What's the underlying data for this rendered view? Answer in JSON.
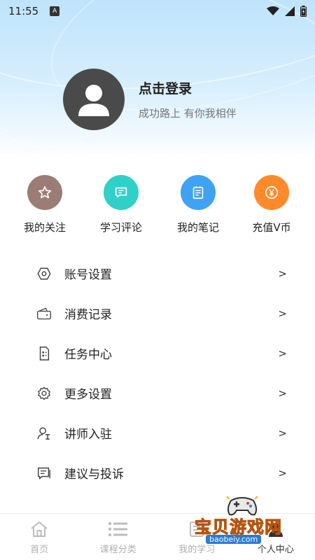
{
  "status_bar": {
    "time": "11:55",
    "notif_letter": "A"
  },
  "profile": {
    "title": "点击登录",
    "subtitle": "成功路上 有你我相伴"
  },
  "quick_actions": [
    {
      "label": "我的关注",
      "color": "#9b7d75",
      "icon": "star-icon"
    },
    {
      "label": "学习评论",
      "color": "#2fd0c8",
      "icon": "comment-icon"
    },
    {
      "label": "我的笔记",
      "color": "#3fa2f3",
      "icon": "note-icon"
    },
    {
      "label": "充值V币",
      "color": "#ff8a2b",
      "icon": "yen-coin-icon"
    }
  ],
  "menu": [
    {
      "label": "账号设置",
      "arrow": ">",
      "icon": "hexagon-settings-icon"
    },
    {
      "label": "消费记录",
      "arrow": ">",
      "icon": "wallet-icon"
    },
    {
      "label": "任务中心",
      "arrow": ">",
      "icon": "task-document-icon"
    },
    {
      "label": "更多设置",
      "arrow": ">",
      "icon": "gear-icon"
    },
    {
      "label": "讲师入驻",
      "arrow": ">",
      "icon": "teacher-icon"
    },
    {
      "label": "建议与投诉",
      "arrow": ">",
      "icon": "feedback-icon"
    }
  ],
  "bottom_nav": [
    {
      "label": "首页",
      "icon": "home-icon"
    },
    {
      "label": "课程分类",
      "icon": "list-icon"
    },
    {
      "label": "我的学习",
      "icon": "study-icon"
    },
    {
      "label": "个人中心",
      "icon": "user-center-icon"
    }
  ],
  "watermark": {
    "text": "宝贝游戏网",
    "url": "baobeiy.com"
  }
}
